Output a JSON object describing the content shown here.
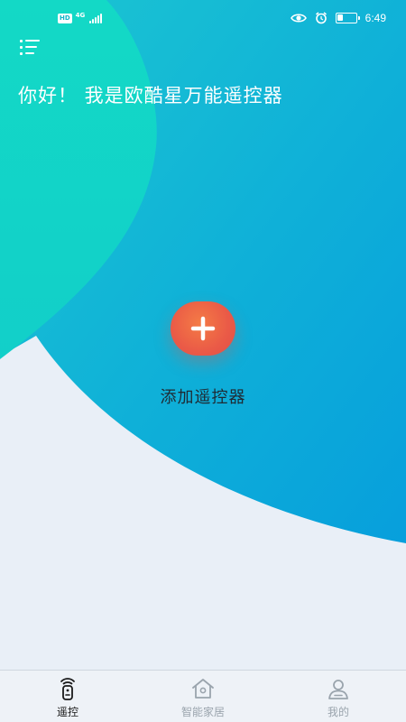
{
  "status_bar": {
    "badge": "HD",
    "network": "4G",
    "time": "6:49",
    "battery_level": 0.3
  },
  "header": {
    "greeting": "你好！ 我是欧酷星万能遥控器"
  },
  "main": {
    "add_remote_label": "添加遥控器"
  },
  "tabs": [
    {
      "label": "遥控",
      "icon": "remote-icon",
      "active": true
    },
    {
      "label": "智能家居",
      "icon": "home-icon",
      "active": false
    },
    {
      "label": "我的",
      "icon": "user-icon",
      "active": false
    }
  ],
  "colors": {
    "accent_teal": "#16d4c3",
    "accent_blue": "#0aa0dc",
    "add_button": "#ea5a47",
    "background": "#e9eff7"
  }
}
